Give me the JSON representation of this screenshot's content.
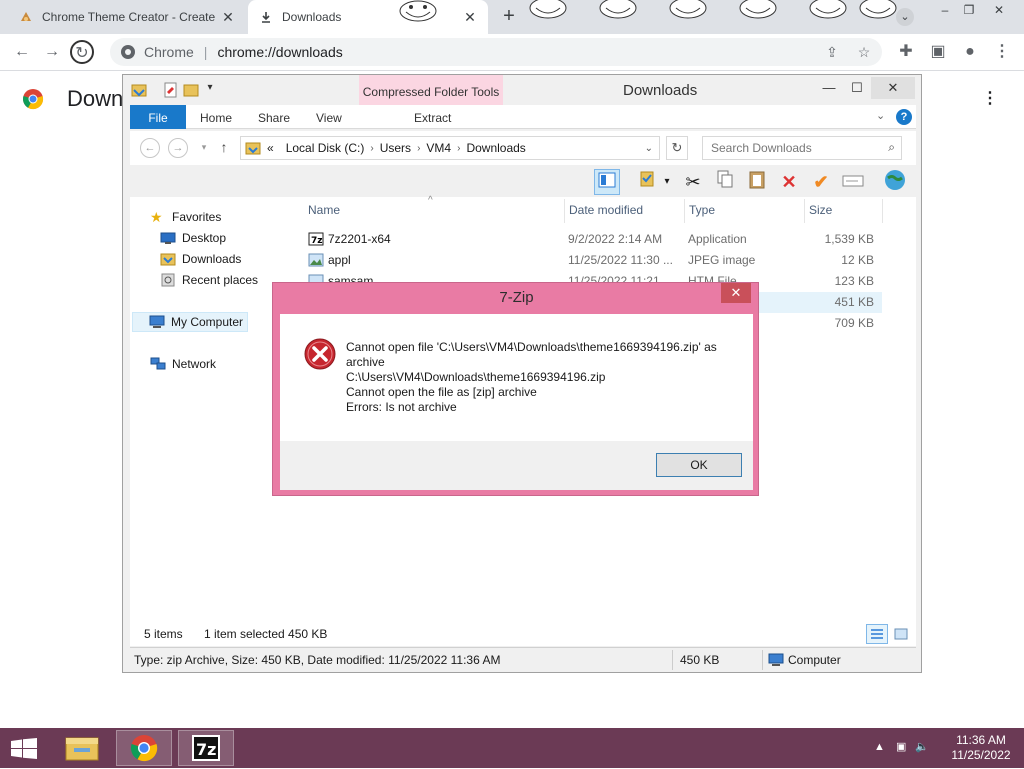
{
  "chrome": {
    "tabs": [
      {
        "title": "Chrome Theme Creator - Create",
        "active": false
      },
      {
        "title": "Downloads",
        "active": true
      }
    ],
    "new_tab_label": "+",
    "omnibox": {
      "site": "Chrome",
      "url": "chrome://downloads"
    },
    "page_title": "Down"
  },
  "explorer": {
    "window_title": "Downloads",
    "context_tab": "Compressed Folder Tools",
    "ribbon_tabs": [
      "File",
      "Home",
      "Share",
      "View",
      "Extract"
    ],
    "breadcrumb": [
      "Local Disk (C:)",
      "Users",
      "VM4",
      "Downloads"
    ],
    "breadcrumb_prefix": "«",
    "search_placeholder": "Search Downloads",
    "nav": {
      "favorites": "Favorites",
      "desktop": "Desktop",
      "downloads": "Downloads",
      "recent": "Recent places",
      "my_computer": "My Computer",
      "network": "Network"
    },
    "columns": [
      "Name",
      "Date modified",
      "Type",
      "Size"
    ],
    "files": [
      {
        "name": "7z2201-x64",
        "date": "9/2/2022 2:14 AM",
        "type": "Application",
        "size": "1,539 KB"
      },
      {
        "name": "appl",
        "date": "11/25/2022 11:30 ...",
        "type": "JPEG image",
        "size": "12 KB"
      },
      {
        "name": "samsam",
        "date": "11/25/2022 11:21 ...",
        "type": "HTM File",
        "size": "123 KB"
      },
      {
        "name": "",
        "date": "",
        "type": "",
        "size": "451 KB"
      },
      {
        "name": "",
        "date": "",
        "type": "",
        "size": "709 KB"
      }
    ],
    "status": {
      "items": "5 items",
      "selected": "1 item selected  450 KB"
    },
    "details": {
      "info": "Type: zip Archive, Size: 450 KB, Date modified: 11/25/2022 11:36 AM",
      "size": "450 KB",
      "location": "Computer"
    }
  },
  "dialog": {
    "title": "7-Zip",
    "lines": [
      "Cannot open file 'C:\\Users\\VM4\\Downloads\\theme1669394196.zip' as",
      "archive",
      "C:\\Users\\VM4\\Downloads\\theme1669394196.zip",
      "Cannot open the file as [zip] archive",
      "Errors: Is not archive"
    ],
    "ok_label": "OK",
    "close_label": "✕"
  },
  "taskbar": {
    "apps": [
      "file-explorer",
      "chrome",
      "7-zip"
    ],
    "time": "11:36 AM",
    "date": "11/25/2022"
  },
  "colors": {
    "dialog_frame": "#e97ba4",
    "taskbar": "#6b3a55",
    "ribbon_file": "#1979ca"
  }
}
